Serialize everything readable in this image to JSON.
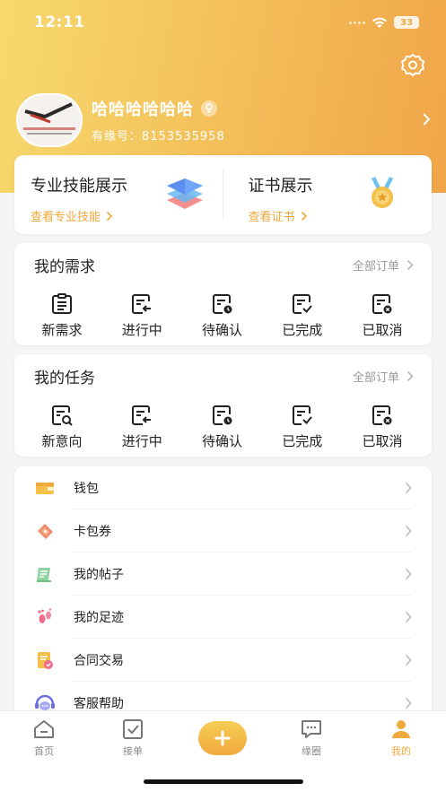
{
  "status_bar": {
    "time": "12:11",
    "battery": "33"
  },
  "profile": {
    "name": "哈哈哈哈哈哈",
    "id_label": "有缘号：",
    "id_value": "8153535958"
  },
  "showcase": {
    "skills": {
      "title": "专业技能展示",
      "link": "查看专业技能"
    },
    "certs": {
      "title": "证书展示",
      "link": "查看证书"
    }
  },
  "demand": {
    "title": "我的需求",
    "more": "全部订单",
    "items": [
      {
        "label": "新需求",
        "icon": "clipboard-icon"
      },
      {
        "label": "进行中",
        "icon": "in-progress-icon"
      },
      {
        "label": "待确认",
        "icon": "pending-confirm-icon"
      },
      {
        "label": "已完成",
        "icon": "completed-icon"
      },
      {
        "label": "已取消",
        "icon": "cancelled-icon"
      }
    ]
  },
  "task": {
    "title": "我的任务",
    "more": "全部订单",
    "items": [
      {
        "label": "新意向",
        "icon": "search-doc-icon"
      },
      {
        "label": "进行中",
        "icon": "in-progress-icon"
      },
      {
        "label": "待确认",
        "icon": "pending-confirm-icon"
      },
      {
        "label": "已完成",
        "icon": "completed-icon"
      },
      {
        "label": "已取消",
        "icon": "cancelled-icon"
      }
    ]
  },
  "menu": [
    {
      "label": "钱包",
      "icon": "wallet-icon"
    },
    {
      "label": "卡包券",
      "icon": "coupon-icon"
    },
    {
      "label": "我的帖子",
      "icon": "post-icon"
    },
    {
      "label": "我的足迹",
      "icon": "footprint-icon"
    },
    {
      "label": "合同交易",
      "icon": "contract-icon"
    },
    {
      "label": "客服帮助",
      "icon": "customer-service-icon"
    }
  ],
  "tabbar": [
    {
      "label": "首页",
      "icon": "home-icon"
    },
    {
      "label": "接单",
      "icon": "accept-order-icon"
    },
    {
      "label": "",
      "icon": "add-icon"
    },
    {
      "label": "缘圈",
      "icon": "chat-icon"
    },
    {
      "label": "我的",
      "icon": "profile-icon"
    }
  ],
  "colors": {
    "accent": "#f0a93c",
    "header_start": "#f6d96d",
    "header_end": "#f0a548"
  }
}
